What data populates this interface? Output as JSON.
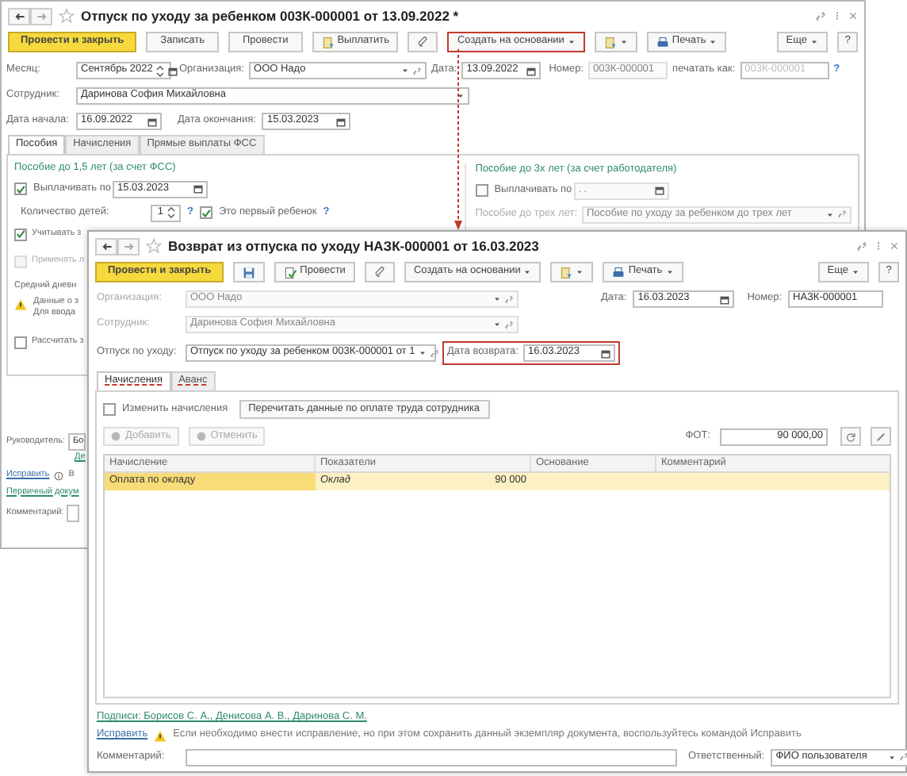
{
  "back_window": {
    "title": "Отпуск по уходу за ребенком 003К-000001 от 13.09.2022 *",
    "toolbar": [
      {
        "kind": "primary",
        "label": "Провести и закрыть"
      },
      {
        "kind": "button",
        "label": "Записать"
      },
      {
        "kind": "button",
        "label": "Провести"
      },
      {
        "kind": "pay",
        "label": "Выплатить"
      },
      {
        "kind": "clip"
      },
      {
        "kind": "menu",
        "label": "Создать на основании",
        "highlighted": true
      },
      {
        "kind": "doc_menu"
      },
      {
        "kind": "print",
        "label": "Печать"
      }
    ],
    "more_button": "Еще",
    "help_button": "?",
    "month": {
      "label": "Месяц:",
      "value": "Сентябрь 2022"
    },
    "organization": {
      "label": "Организация:",
      "value": "ООО Надо"
    },
    "date": {
      "label": "Дата:",
      "value": "13.09.2022"
    },
    "number": {
      "label": "Номер:",
      "value": "003К-000001"
    },
    "print_as": {
      "label": "печатать как:",
      "placeholder": "003К-000001",
      "help": "?"
    },
    "employee": {
      "label": "Сотрудник:",
      "value": "Даринова София Михайловна"
    },
    "start_date": {
      "label": "Дата начала:",
      "value": "16.09.2022"
    },
    "end_date": {
      "label": "Дата окончания:",
      "value": "15.03.2023"
    },
    "tabs": [
      {
        "label": "Пособия",
        "selected": true
      },
      {
        "label": "Начисления",
        "selected": false
      },
      {
        "label": "Прямые выплаты ФСС",
        "selected": false
      }
    ],
    "benefit_15": {
      "heading": "Пособие до 1,5 лет (за счет ФСС)",
      "pay_label": "Выплачивать по",
      "pay_checked": true,
      "pay_value": "15.03.2023",
      "children_label": "Количество детей:",
      "children_value": "1",
      "children_help": "?",
      "first_label": "Это первый ребенок",
      "first_checked": true,
      "first_help": "?",
      "consider_label": "Учитывать з",
      "consider_checked": true
    },
    "benefit_3": {
      "heading": "Пособие до 3х лет (за счет работодателя)",
      "pay_label": "Выплачивать по",
      "pay_checked": false,
      "pay_value": ". .",
      "type_label": "Пособие до трех лет:",
      "type_value": "Пособие по уходу за ребенком до трех лет"
    },
    "apply": {
      "label": "Применять л",
      "checked": false
    },
    "avg_daily": "Средний дневн",
    "warning_lines": [
      "Данные о з",
      "Для ввода"
    ],
    "calculate": {
      "label": "Рассчитать з",
      "checked": false
    },
    "manager": {
      "label": "Руководитель:",
      "value": "Бо"
    },
    "manager_link": "Де",
    "fix_link": "Исправить",
    "fix_note": "В",
    "primary_doc_link": "Первичный докум",
    "comment_label": "Комментарий:"
  },
  "front_window": {
    "title": "Возврат из отпуска по уходу НАЗК-000001 от 16.03.2023",
    "toolbar": [
      {
        "kind": "primary",
        "label": "Провести и закрыть"
      },
      {
        "kind": "save"
      },
      {
        "kind": "post",
        "label": "Провести"
      },
      {
        "kind": "clip"
      },
      {
        "kind": "menu",
        "label": "Создать на основании",
        "highlighted": false
      },
      {
        "kind": "doc_menu"
      },
      {
        "kind": "print",
        "label": "Печать"
      }
    ],
    "more_button": "Еще",
    "help_button": "?",
    "organization": {
      "label": "Организация:",
      "value": "ООО Надо",
      "disabled": true
    },
    "date": {
      "label": "Дата:",
      "value": "16.03.2023"
    },
    "number": {
      "label": "Номер:",
      "value": "НАЗК-000001"
    },
    "employee": {
      "label": "Сотрудник:",
      "value": "Даринова София Михайловна",
      "disabled": true
    },
    "leave": {
      "label": "Отпуск по уходу:",
      "value": "Отпуск по уходу за ребенком 003К-000001 от 1"
    },
    "return_date": {
      "label": "Дата возврата:",
      "value": "16.03.2023",
      "highlighted": true
    },
    "tabs": [
      {
        "label": "Начисления",
        "selected": true,
        "highlighted": true
      },
      {
        "label": "Аванс",
        "selected": false,
        "highlighted": true
      }
    ],
    "change_accruals": {
      "label": "Изменить начисления",
      "checked": false
    },
    "reread_button": "Перечитать данные по оплате труда сотрудника",
    "add_button": {
      "label": "Добавить",
      "disabled": true
    },
    "cancel_button": {
      "label": "Отменить",
      "disabled": true
    },
    "payroll": {
      "label": "ФОТ:",
      "value": "90 000,00"
    },
    "table": {
      "columns": [
        "Начисление",
        "Показатели",
        "Основание",
        "Комментарий"
      ],
      "rows": [
        {
          "accrual": "Оплата по окладу",
          "indicator": "Оклад",
          "amount": "90 000",
          "selected": true
        }
      ]
    },
    "signatures_link": "Подписи: Борисов С. А., Денисова А. В., Даринова С. М.",
    "fix_link": "Исправить",
    "fix_note": "Если необходимо внести исправление, но при этом сохранить данный экземпляр документа, воспользуйтесь командой Исправить",
    "comment_label": "Комментарий:",
    "responsible": {
      "label": "Ответственный:",
      "value": "ФИО пользователя"
    }
  }
}
